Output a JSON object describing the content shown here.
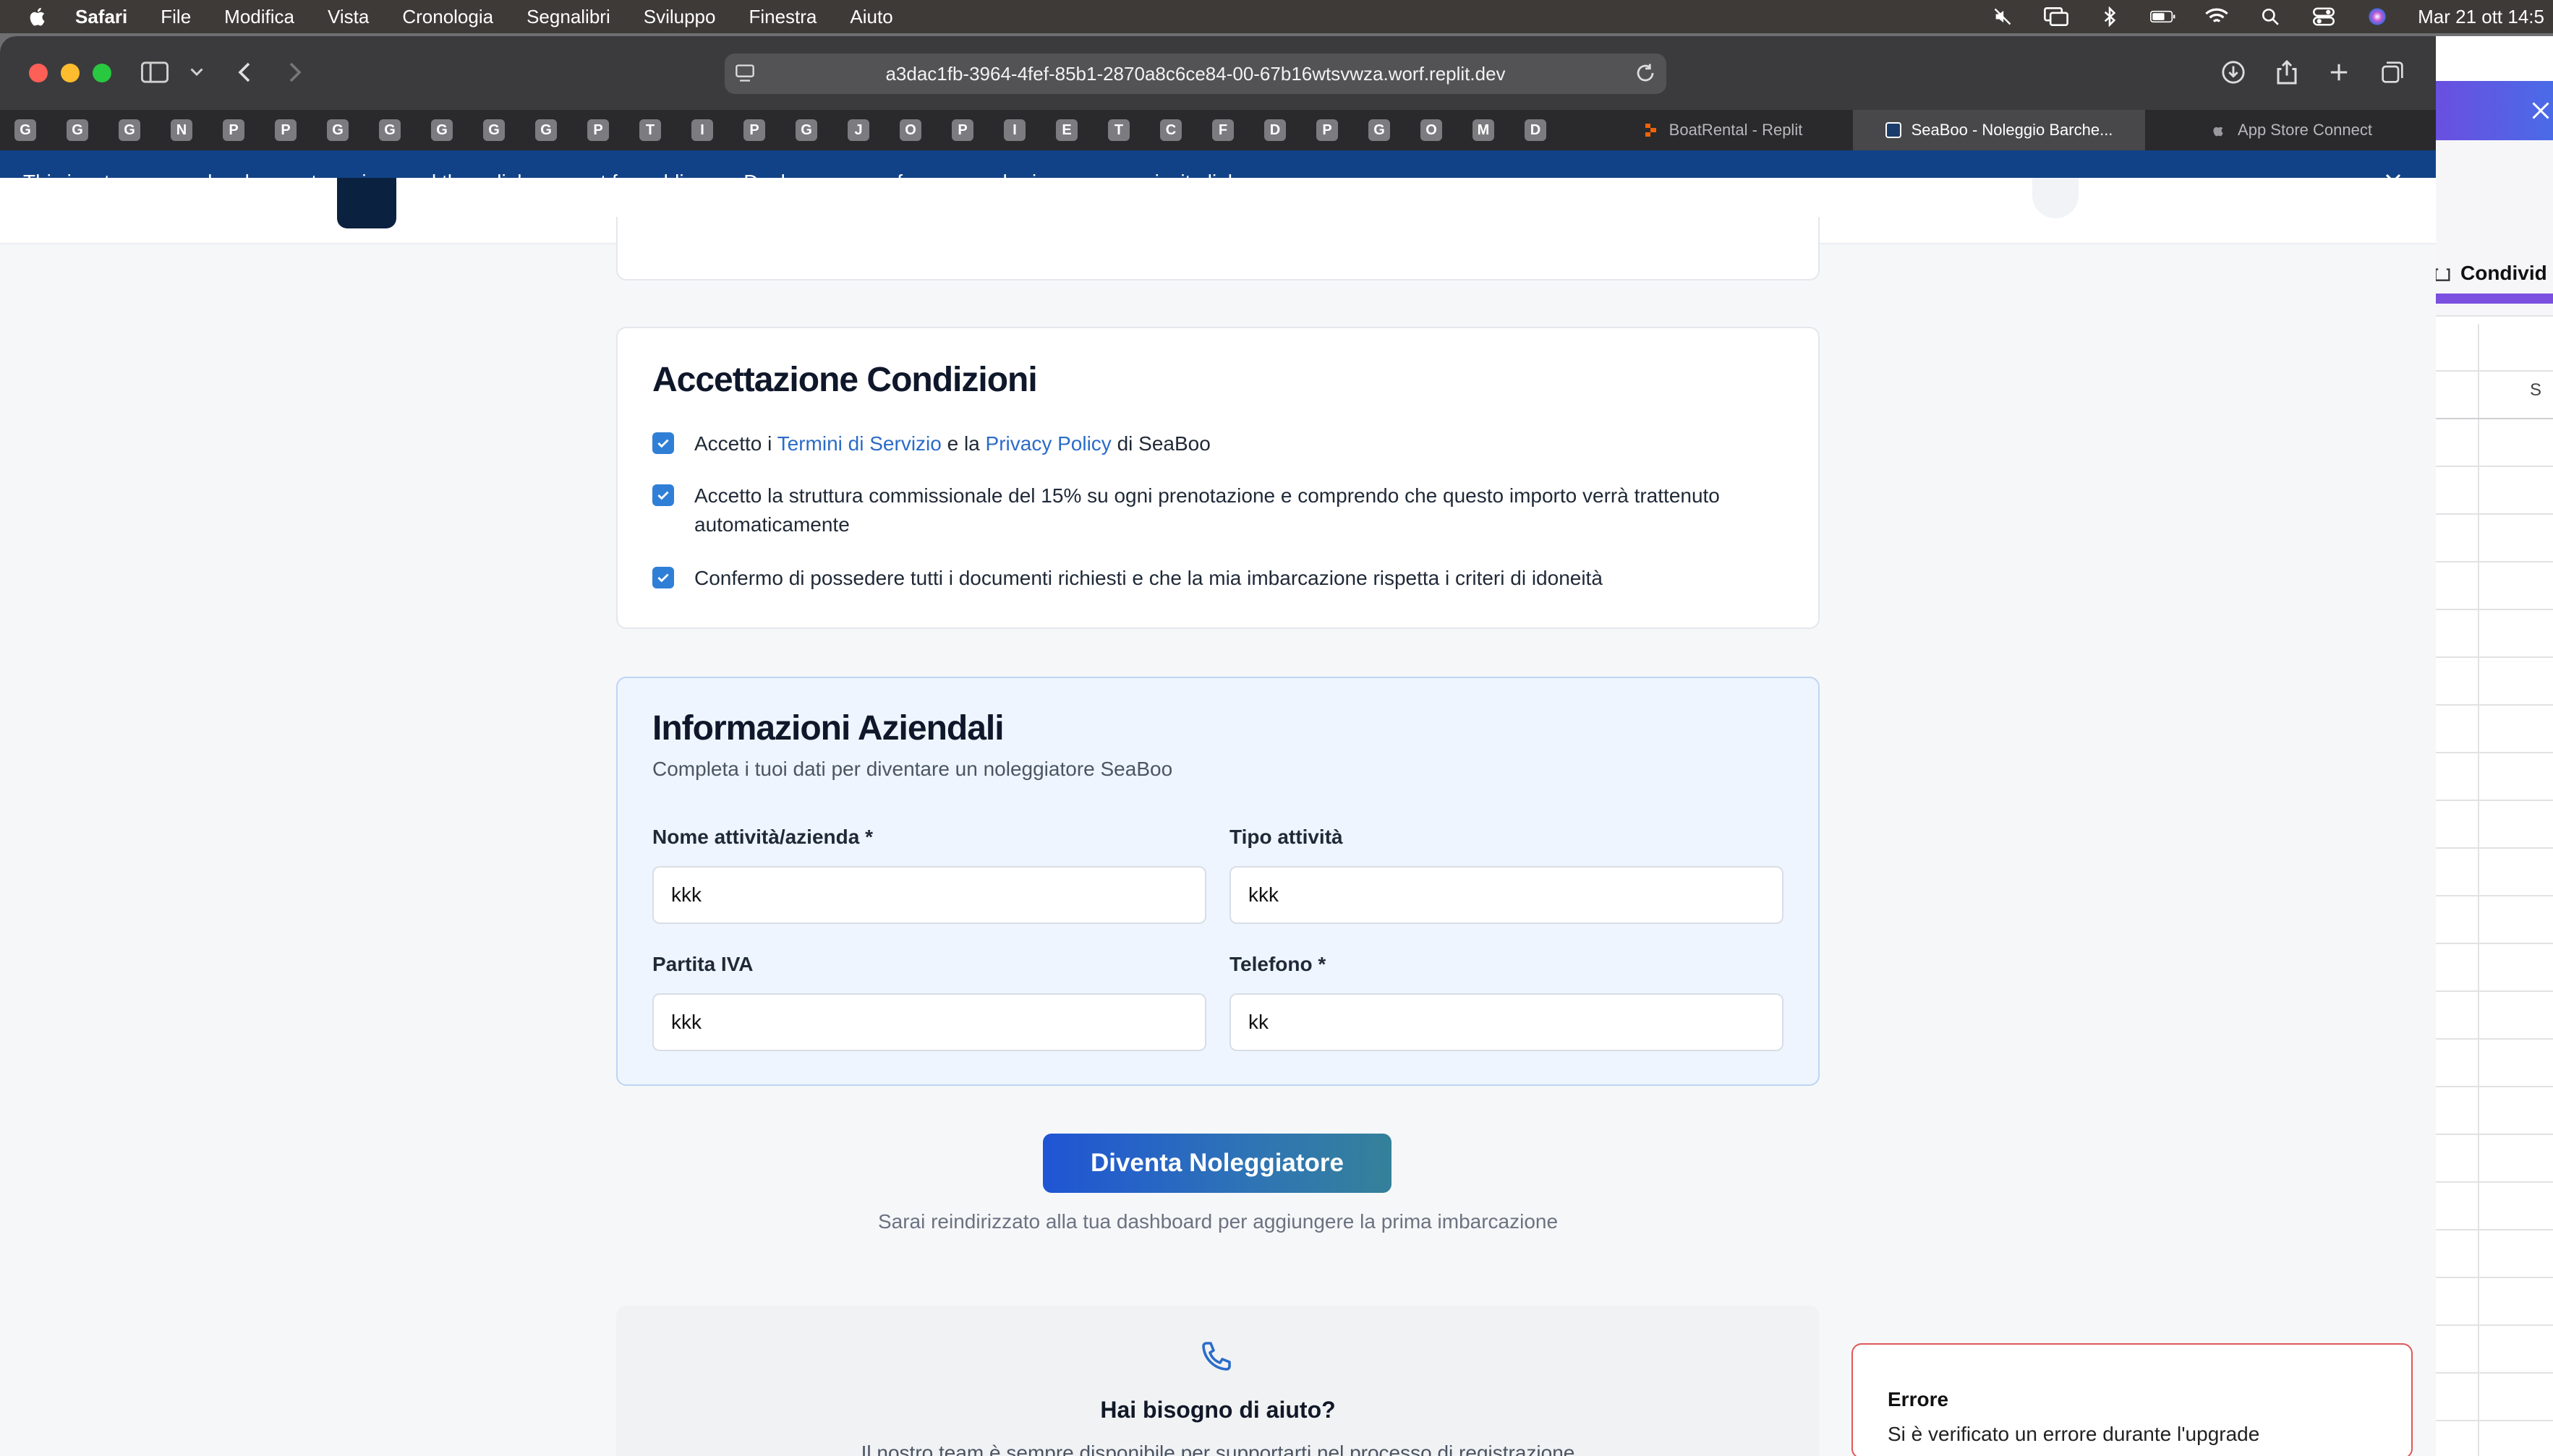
{
  "menubar": {
    "items": [
      "Safari",
      "File",
      "Modifica",
      "Vista",
      "Cronologia",
      "Segnalibri",
      "Sviluppo",
      "Finestra",
      "Aiuto"
    ],
    "clock": "Mar 21 ott  14:5"
  },
  "browser": {
    "url": "a3dac1fb-3964-4fef-85b1-2870a8c6ce84-00-67b16wtsvwza.worf.replit.dev",
    "pinned_tabs": [
      "G",
      "G",
      "G",
      "N",
      "P",
      "P",
      "G",
      "G",
      "G",
      "G",
      "G",
      "P",
      "T",
      "I",
      "P",
      "G",
      "J",
      "O",
      "P",
      "I",
      "E",
      "T",
      "C",
      "F",
      "D",
      "P",
      "G",
      "O",
      "M",
      "D"
    ],
    "tabs": [
      {
        "title": "BoatRental - Replit"
      },
      {
        "title": "SeaBoo - Noleggio Barche..."
      },
      {
        "title": "App Store Connect"
      }
    ]
  },
  "devbar": {
    "text_before": "This is a temporary development preview, and these links are not for public use.",
    "link": "Deploy your app",
    "text_after": "for secure sharing or use an invite link."
  },
  "terms": {
    "title": "Accettazione Condizioni",
    "items": [
      {
        "pre": "Accetto i ",
        "link1": "Termini di Servizio",
        "mid": " e la ",
        "link2": "Privacy Policy",
        "post": " di SeaBoo",
        "checked": true
      },
      {
        "text": "Accetto la struttura commissionale del 15% su ogni prenotazione e comprendo che questo importo verrà trattenuto automaticamente",
        "checked": true
      },
      {
        "text": "Confermo di possedere tutti i documenti richiesti e che la mia imbarcazione rispetta i criteri di idoneità",
        "checked": true
      }
    ]
  },
  "business": {
    "title": "Informazioni Aziendali",
    "subtitle": "Completa i tuoi dati per diventare un noleggiatore SeaBoo",
    "fields": [
      {
        "label": "Nome attività/azienda *",
        "value": "kkk"
      },
      {
        "label": "Tipo attività",
        "value": "kkk"
      },
      {
        "label": "Partita IVA",
        "value": "kkk"
      },
      {
        "label": "Telefono *",
        "value": "kk"
      }
    ]
  },
  "cta": {
    "label": "Diventa Noleggiatore",
    "note": "Sarai reindirizzato alla tua dashboard per aggiungere la prima imbarcazione"
  },
  "help": {
    "title": "Hai bisogno di aiuto?",
    "text": "Il nostro team è sempre disponibile per supportarti nel processo di registrazione"
  },
  "toast": {
    "title": "Errore",
    "message": "Si è verificato un errore durante l'upgrade"
  },
  "background_app": {
    "share_label": "Condivid",
    "column_letter": "S"
  },
  "colors": {
    "accent": "#2b6cc8",
    "devbar": "#114287",
    "checkbox": "#2f7fd6",
    "toast_border": "#e05757"
  }
}
